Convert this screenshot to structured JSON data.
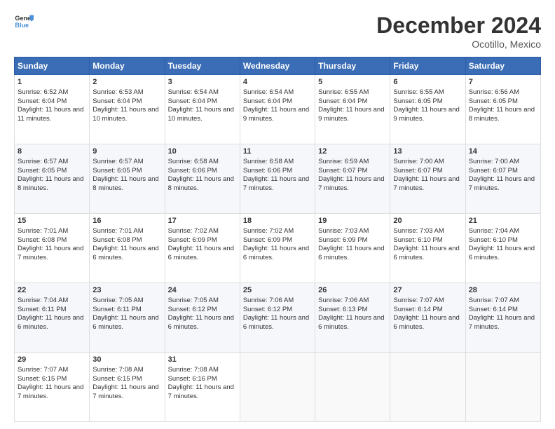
{
  "logo": {
    "line1": "General",
    "line2": "Blue"
  },
  "title": "December 2024",
  "subtitle": "Ocotillo, Mexico",
  "days_of_week": [
    "Sunday",
    "Monday",
    "Tuesday",
    "Wednesday",
    "Thursday",
    "Friday",
    "Saturday"
  ],
  "weeks": [
    [
      {
        "day": "1",
        "sunrise": "6:52 AM",
        "sunset": "6:04 PM",
        "daylight": "11 hours and 11 minutes."
      },
      {
        "day": "2",
        "sunrise": "6:53 AM",
        "sunset": "6:04 PM",
        "daylight": "11 hours and 10 minutes."
      },
      {
        "day": "3",
        "sunrise": "6:54 AM",
        "sunset": "6:04 PM",
        "daylight": "11 hours and 10 minutes."
      },
      {
        "day": "4",
        "sunrise": "6:54 AM",
        "sunset": "6:04 PM",
        "daylight": "11 hours and 9 minutes."
      },
      {
        "day": "5",
        "sunrise": "6:55 AM",
        "sunset": "6:04 PM",
        "daylight": "11 hours and 9 minutes."
      },
      {
        "day": "6",
        "sunrise": "6:55 AM",
        "sunset": "6:05 PM",
        "daylight": "11 hours and 9 minutes."
      },
      {
        "day": "7",
        "sunrise": "6:56 AM",
        "sunset": "6:05 PM",
        "daylight": "11 hours and 8 minutes."
      }
    ],
    [
      {
        "day": "8",
        "sunrise": "6:57 AM",
        "sunset": "6:05 PM",
        "daylight": "11 hours and 8 minutes."
      },
      {
        "day": "9",
        "sunrise": "6:57 AM",
        "sunset": "6:05 PM",
        "daylight": "11 hours and 8 minutes."
      },
      {
        "day": "10",
        "sunrise": "6:58 AM",
        "sunset": "6:06 PM",
        "daylight": "11 hours and 8 minutes."
      },
      {
        "day": "11",
        "sunrise": "6:58 AM",
        "sunset": "6:06 PM",
        "daylight": "11 hours and 7 minutes."
      },
      {
        "day": "12",
        "sunrise": "6:59 AM",
        "sunset": "6:07 PM",
        "daylight": "11 hours and 7 minutes."
      },
      {
        "day": "13",
        "sunrise": "7:00 AM",
        "sunset": "6:07 PM",
        "daylight": "11 hours and 7 minutes."
      },
      {
        "day": "14",
        "sunrise": "7:00 AM",
        "sunset": "6:07 PM",
        "daylight": "11 hours and 7 minutes."
      }
    ],
    [
      {
        "day": "15",
        "sunrise": "7:01 AM",
        "sunset": "6:08 PM",
        "daylight": "11 hours and 7 minutes."
      },
      {
        "day": "16",
        "sunrise": "7:01 AM",
        "sunset": "6:08 PM",
        "daylight": "11 hours and 6 minutes."
      },
      {
        "day": "17",
        "sunrise": "7:02 AM",
        "sunset": "6:09 PM",
        "daylight": "11 hours and 6 minutes."
      },
      {
        "day": "18",
        "sunrise": "7:02 AM",
        "sunset": "6:09 PM",
        "daylight": "11 hours and 6 minutes."
      },
      {
        "day": "19",
        "sunrise": "7:03 AM",
        "sunset": "6:09 PM",
        "daylight": "11 hours and 6 minutes."
      },
      {
        "day": "20",
        "sunrise": "7:03 AM",
        "sunset": "6:10 PM",
        "daylight": "11 hours and 6 minutes."
      },
      {
        "day": "21",
        "sunrise": "7:04 AM",
        "sunset": "6:10 PM",
        "daylight": "11 hours and 6 minutes."
      }
    ],
    [
      {
        "day": "22",
        "sunrise": "7:04 AM",
        "sunset": "6:11 PM",
        "daylight": "11 hours and 6 minutes."
      },
      {
        "day": "23",
        "sunrise": "7:05 AM",
        "sunset": "6:11 PM",
        "daylight": "11 hours and 6 minutes."
      },
      {
        "day": "24",
        "sunrise": "7:05 AM",
        "sunset": "6:12 PM",
        "daylight": "11 hours and 6 minutes."
      },
      {
        "day": "25",
        "sunrise": "7:06 AM",
        "sunset": "6:12 PM",
        "daylight": "11 hours and 6 minutes."
      },
      {
        "day": "26",
        "sunrise": "7:06 AM",
        "sunset": "6:13 PM",
        "daylight": "11 hours and 6 minutes."
      },
      {
        "day": "27",
        "sunrise": "7:07 AM",
        "sunset": "6:14 PM",
        "daylight": "11 hours and 6 minutes."
      },
      {
        "day": "28",
        "sunrise": "7:07 AM",
        "sunset": "6:14 PM",
        "daylight": "11 hours and 7 minutes."
      }
    ],
    [
      {
        "day": "29",
        "sunrise": "7:07 AM",
        "sunset": "6:15 PM",
        "daylight": "11 hours and 7 minutes."
      },
      {
        "day": "30",
        "sunrise": "7:08 AM",
        "sunset": "6:15 PM",
        "daylight": "11 hours and 7 minutes."
      },
      {
        "day": "31",
        "sunrise": "7:08 AM",
        "sunset": "6:16 PM",
        "daylight": "11 hours and 7 minutes."
      },
      null,
      null,
      null,
      null
    ]
  ]
}
